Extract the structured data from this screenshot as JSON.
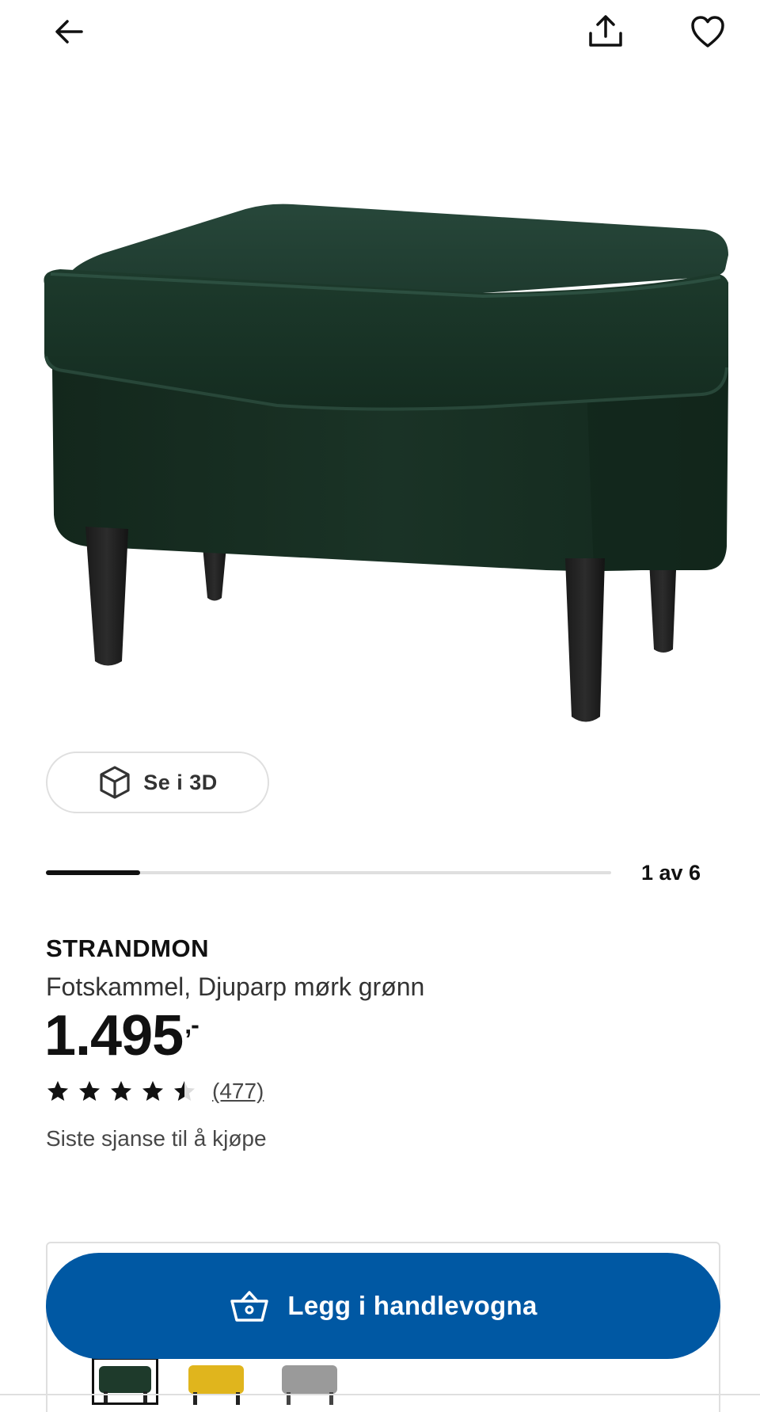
{
  "header": {
    "back_icon": "arrow-left-icon",
    "share_icon": "share-icon",
    "favourite_icon": "heart-icon"
  },
  "gallery": {
    "view_3d_label": "Se i 3D",
    "view_3d_icon": "cube-icon",
    "position_text": "1 av 6",
    "current_index": 1,
    "total": 6
  },
  "product": {
    "name": "STRANDMON",
    "description": "Fotskammel, Djuparp mørk grønn",
    "price_main": "1.495",
    "price_suffix": ",-",
    "rating": 4.5,
    "rating_max": 5,
    "review_count": "(477)",
    "availability": "Siste sjanse til å kjøpe"
  },
  "cta": {
    "label": "Legg i handlevogna",
    "icon": "shopping-basket-icon",
    "color": "#0058a3"
  },
  "variants": [
    {
      "name": "green",
      "color": "#1e3a2b",
      "selected": true
    },
    {
      "name": "yellow",
      "color": "#e0b51d",
      "selected": false
    },
    {
      "name": "grey",
      "color": "#9a9a9a",
      "selected": false
    }
  ]
}
